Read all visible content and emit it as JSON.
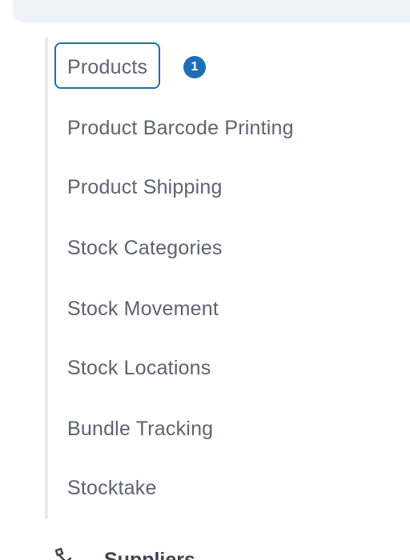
{
  "submenu": {
    "items": [
      {
        "label": "Products",
        "active": true
      },
      {
        "label": "Product Barcode Printing"
      },
      {
        "label": "Product Shipping"
      },
      {
        "label": "Stock Categories"
      },
      {
        "label": "Stock Movement"
      },
      {
        "label": "Stock Locations"
      },
      {
        "label": "Bundle Tracking"
      },
      {
        "label": "Stocktake"
      }
    ],
    "badge": "1"
  },
  "next_section": {
    "label": "Suppliers",
    "icon": "supplier-icon"
  },
  "colors": {
    "accent": "#1e6fb3",
    "text": "#5b6472",
    "panel_bg": "#eef3f8",
    "rail": "#e6ebf1"
  }
}
